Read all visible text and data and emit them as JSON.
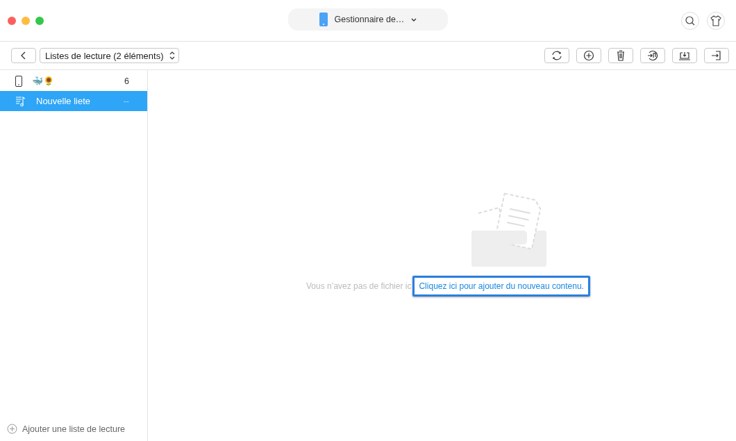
{
  "window": {
    "device_menu": "Gestionnaire de…"
  },
  "toolbar": {
    "breadcrumb": "Listes de lecture (2 éléments)",
    "actions": [
      {
        "kind": "refresh"
      },
      {
        "kind": "add"
      },
      {
        "kind": "delete"
      },
      {
        "kind": "to-itunes"
      },
      {
        "kind": "to-computer"
      },
      {
        "kind": "to-device"
      }
    ]
  },
  "sidebar": {
    "items": [
      {
        "kind": "device",
        "label": "🐳🌻",
        "count": "6",
        "selected": false
      },
      {
        "kind": "playlist",
        "label": "Nouvelle liete",
        "count": "--",
        "selected": true
      }
    ],
    "add_button": "Ajouter une liste de lecture"
  },
  "empty_state": {
    "message": "Vous n’avez pas de fichier ic",
    "link": "Cliquez ici pour ajouter du nouveau contenu.",
    "link_highlighted": true
  }
}
